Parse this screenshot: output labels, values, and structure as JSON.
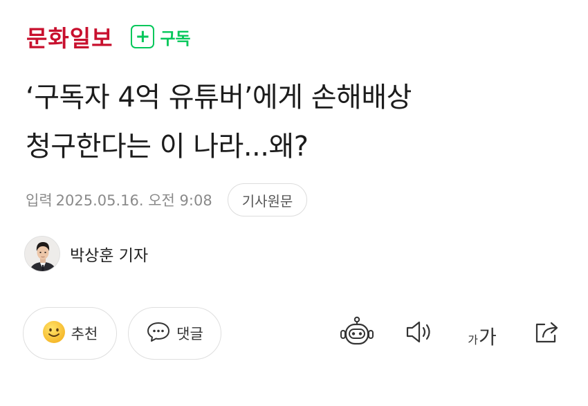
{
  "header": {
    "press_name": "문화일보",
    "subscribe_plus": "+",
    "subscribe_label": "구독"
  },
  "article": {
    "title_line1": "‘구독자 4억 유튜버’에게 손해배상",
    "title_line2": "청구한다는 이 나라...왜?",
    "date_label": "입력",
    "date_value": "2025.05.16. 오전 9:08",
    "original_button": "기사원문",
    "author": "박상훈 기자"
  },
  "actions": {
    "like_label": "추천",
    "comment_label": "댓글",
    "font_size_small": "가",
    "font_size_large": "가"
  },
  "icons": {
    "like": "smiley-icon",
    "comment": "speech-bubble-icon",
    "summary": "robot-icon",
    "listen": "speaker-icon",
    "share": "share-icon"
  },
  "colors": {
    "press_red": "#c8102e",
    "subscribe_green": "#03c75a",
    "meta_gray": "#8a8a8a"
  }
}
